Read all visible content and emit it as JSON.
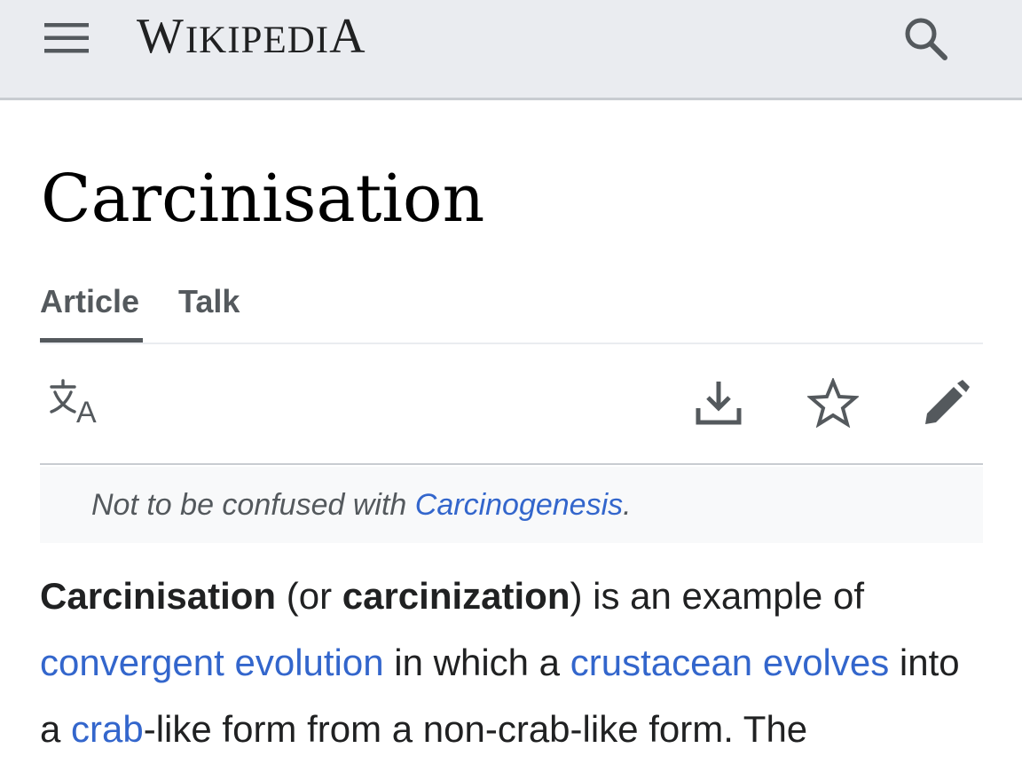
{
  "header": {
    "menu_icon": "hamburger-menu-icon",
    "wordmark": "WIKIPEDIA",
    "search_icon": "search-icon"
  },
  "page": {
    "title": "Carcinisation"
  },
  "tabs": [
    {
      "label": "Article",
      "active": true
    },
    {
      "label": "Talk",
      "active": false
    }
  ],
  "actions": {
    "language_icon": "language-translate-icon",
    "download_icon": "download-icon",
    "watch_icon": "star-icon",
    "edit_icon": "pencil-icon"
  },
  "hatnote": {
    "prefix": "Not to be confused with ",
    "link": "Carcinogenesis",
    "suffix": "."
  },
  "lead": {
    "term": "Carcinisation",
    "open_paren": " (or ",
    "alt_term": "carcinization",
    "after_alt": ") is an example of ",
    "link1": "convergent evolution",
    "text2": " in which a ",
    "link2": "crustacean evolves",
    "text3": " into a ",
    "link3": "crab",
    "text4": "-like form from a non-crab-like form. The"
  },
  "colors": {
    "header_bg": "#eaecf0",
    "link": "#3366cc",
    "text": "#202122",
    "muted": "#54595d",
    "hatnote_bg": "#f8f9fa"
  }
}
